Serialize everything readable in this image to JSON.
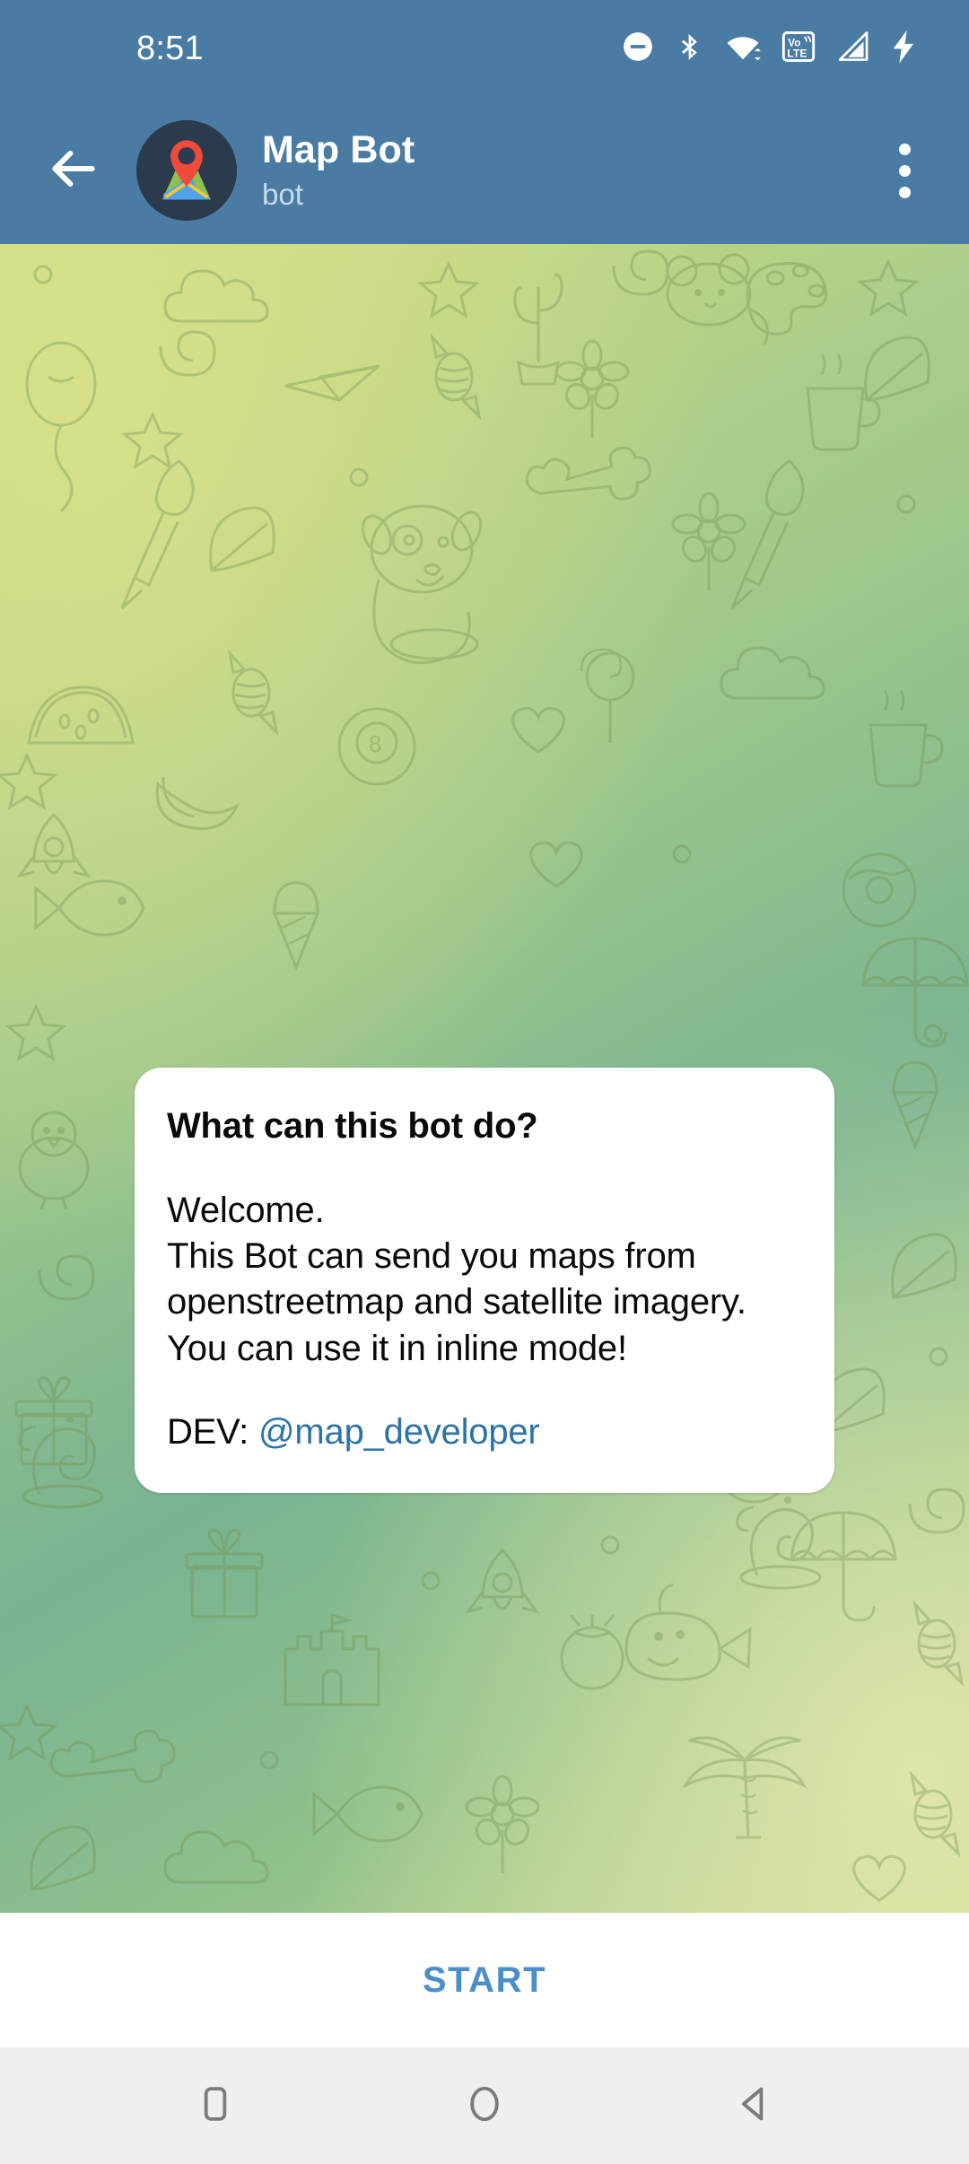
{
  "status_bar": {
    "time": "8:51",
    "icons": [
      {
        "name": "do-not-disturb-icon",
        "label": "Do not disturb"
      },
      {
        "name": "bluetooth-icon",
        "label": "Bluetooth"
      },
      {
        "name": "wifi-icon",
        "label": "Wi-Fi"
      },
      {
        "name": "volte-icon",
        "label": "VoLTE"
      },
      {
        "name": "cellular-signal-icon",
        "label": "Signal"
      },
      {
        "name": "battery-charging-icon",
        "label": "Charging"
      }
    ],
    "volte_top_text": "Vo",
    "volte_bottom_text": "LTE",
    "background_color": "#4a7ba3",
    "foreground_color": "#ffffff"
  },
  "app_bar": {
    "back_icon": "arrow-left-icon",
    "avatar_icon": "map-pin-avatar",
    "title": "Map Bot",
    "subtitle": "bot",
    "overflow_icon": "more-vertical-icon",
    "background_color": "#4a7ba3",
    "title_color": "#ffffff",
    "subtitle_color": "#c5dcee"
  },
  "chat": {
    "wallpaper": "telegram-doodle-pattern",
    "wallpaper_colors": [
      "#cfdd84",
      "#9dc78c",
      "#79b391",
      "#ccdc93"
    ],
    "message": {
      "heading": "What can this bot do?",
      "body": "Welcome.\nThis Bot can send you maps from openstreetmap and satellite imagery.\nYou can use it in inline mode!",
      "dev_label": "DEV: ",
      "dev_handle": "@map_developer",
      "link_color": "#2b73a8",
      "bubble_color": "#ffffff",
      "text_color": "#0a0a0a"
    }
  },
  "start_bar": {
    "label": "START",
    "color": "#4a8fc9",
    "background_color": "#ffffff"
  },
  "nav_bar": {
    "background_color": "#efefef",
    "icon_color": "#7b7b7b",
    "buttons": [
      {
        "name": "nav-recents-button",
        "icon": "square-icon",
        "label": "Recents"
      },
      {
        "name": "nav-home-button",
        "icon": "circle-icon",
        "label": "Home"
      },
      {
        "name": "nav-back-button",
        "icon": "triangle-left-icon",
        "label": "Back"
      }
    ]
  }
}
